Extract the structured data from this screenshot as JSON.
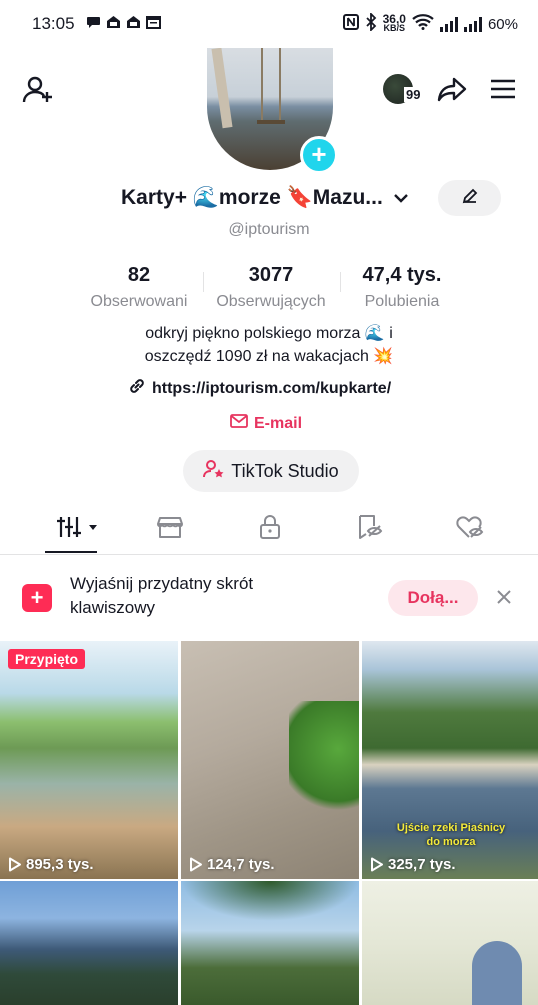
{
  "status_bar": {
    "time": "13:05",
    "net_speed_value": "36,0",
    "net_speed_unit": "KB/S",
    "battery": "60%"
  },
  "header": {
    "notification_count": "99"
  },
  "profile": {
    "name": "Karty+ 🌊morze 🔖Mazu...",
    "handle": "@iptourism",
    "stats": [
      {
        "value": "82",
        "label": "Obserwowani"
      },
      {
        "value": "3077",
        "label": "Obserwujących"
      },
      {
        "value": "47,4 tys.",
        "label": "Polubienia"
      }
    ],
    "bio_line1": "odkryj piękno polskiego morza 🌊 i",
    "bio_line2": "oszczędź 1090 zł na wakacjach 💥",
    "link": "https://iptourism.com/kupkarte/",
    "email_label": "E-mail",
    "studio_label": "TikTok Studio"
  },
  "tabs": [
    "videos-tab",
    "shop-tab",
    "private-tab",
    "reposts-tab",
    "liked-tab"
  ],
  "banner": {
    "text": "Wyjaśnij przydatny skrót klawiszowy",
    "join_label": "Dołą..."
  },
  "videos": [
    {
      "views": "895,3 tys.",
      "pinned_label": "Przypięto"
    },
    {
      "views": "124,7 tys."
    },
    {
      "views": "325,7 tys.",
      "caption_line1": "Ujście rzeki Piaśnicy",
      "caption_line2": "do morza"
    },
    {
      "views": ""
    },
    {
      "views": ""
    },
    {
      "views": ""
    }
  ],
  "colors": {
    "brand_red": "#fe2c55",
    "link_red": "#e7345f",
    "plus_cyan": "#20d5ec",
    "text": "#161823",
    "muted": "#8a8b91"
  }
}
